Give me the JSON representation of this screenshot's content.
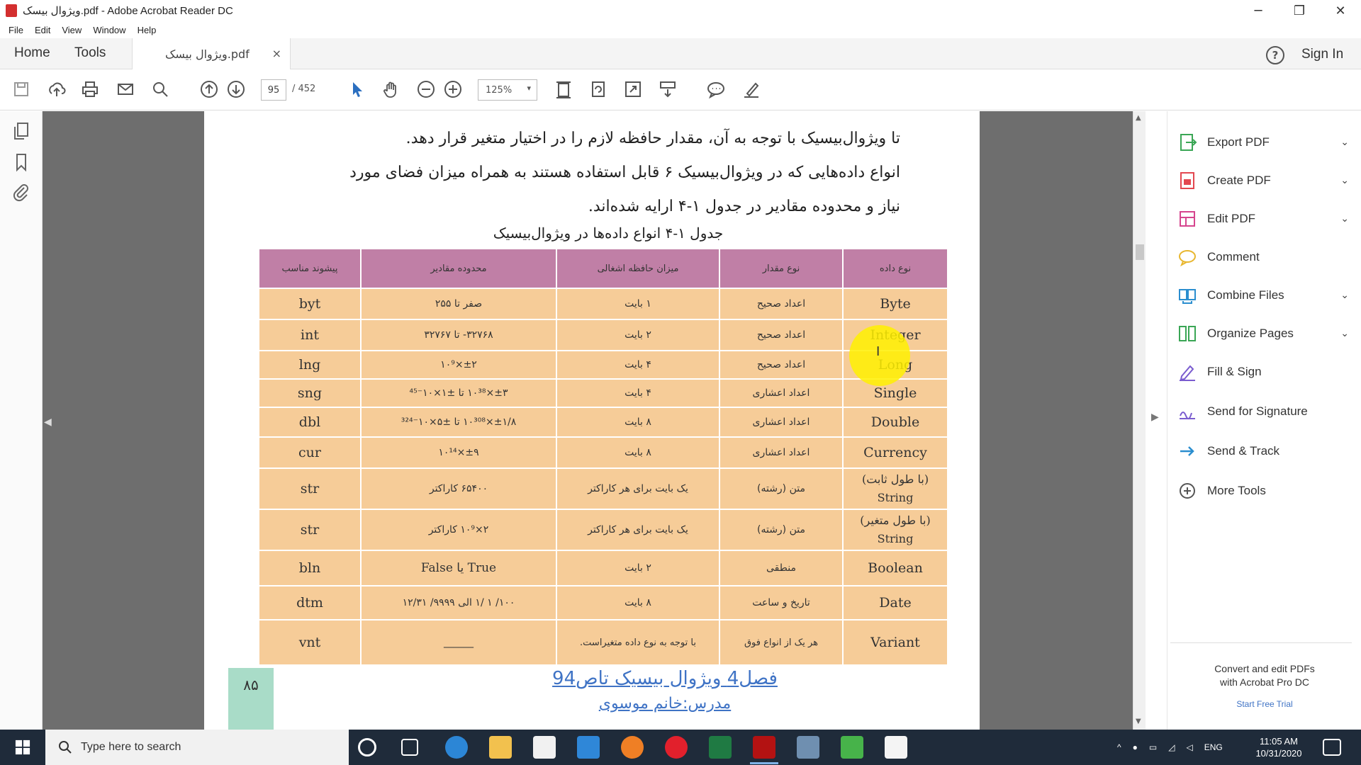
{
  "window": {
    "title": "ويژوال بيسک.pdf - Adobe Acrobat Reader DC",
    "controls": [
      "─",
      "❐",
      "✕"
    ]
  },
  "menu": [
    "File",
    "Edit",
    "View",
    "Window",
    "Help"
  ],
  "tabs": {
    "home": "Home",
    "tools": "Tools",
    "document": "ويژوال بيسک.pdf",
    "close": "×",
    "help": "?",
    "sign_in": "Sign In"
  },
  "toolbar": {
    "page_current": "95",
    "page_total": "/ 452",
    "zoom": "125%",
    "zoom_caret": "▾"
  },
  "document": {
    "paragraphs": [
      "تا ويژوال‌بيسيک با توجه به آن، مقدار حافظه لازم را در اختيار متغير قرار دهد.",
      "انواع داده‌هايی که در ويژوال‌بيسيک ۶ قابل استفاده هستند به همراه ميزان فضای مورد",
      "نياز و محدوده مقادير در جدول ۱-۴ ارايه شده‌اند."
    ],
    "caption": "جدول ۱-۴ انواع داده‌ها در ويژوال‌بيسيک",
    "table": {
      "headers": [
        "پيشوند مناسب",
        "محدوده مقادير",
        "ميزان حافظه اشغالی",
        "نوع مقدار",
        "نوع داده"
      ],
      "rows": [
        [
          "byt",
          "صفر تا ۲۵۵",
          "۱ بايت",
          "اعداد صحيح",
          "Byte"
        ],
        [
          "int",
          "۳۲۷۶۸- تا ۳۲۷۶۷",
          "۲ بايت",
          "اعداد صحيح",
          "Integer"
        ],
        [
          "lng",
          "±۲×۱۰⁹",
          "۴ بايت",
          "اعداد صحيح",
          "Long"
        ],
        [
          "sng",
          "±۳×۱۰³⁸ تا ±۱×۱۰⁻⁴⁵",
          "۴ بايت",
          "اعداد اعشاری",
          "Single"
        ],
        [
          "dbl",
          "±۱/۸×۱۰³⁰⁸ تا ±۵×۱۰⁻³²⁴",
          "۸ بايت",
          "اعداد اعشاری",
          "Double"
        ],
        [
          "cur",
          "±۹×۱۰¹⁴",
          "۸ بايت",
          "اعداد اعشاری",
          "Currency"
        ],
        [
          "str",
          "۶۵۴۰۰ کاراکتر",
          "يک بايت برای هر کاراکتر",
          "متن (رشته)",
          "(با طول ثابت) String"
        ],
        [
          "str",
          "۲×۱۰⁹ کاراکتر",
          "يک بايت برای هر کاراکتر",
          "متن (رشته)",
          "(با طول متغير) String"
        ],
        [
          "bln",
          "True يا False",
          "۲ بايت",
          "منطقی",
          "Boolean"
        ],
        [
          "dtm",
          "۱۰۰/ ۱ /۱ الی ۹۹۹۹/ ۱۲/۳۱",
          "۸ بايت",
          "تاريخ و ساعت",
          "Date"
        ],
        [
          "vnt",
          "______",
          "با توجه به نوع داده متغيراست.",
          "هر يک از انواع فوق",
          "Variant"
        ]
      ]
    },
    "page_number": "۸۵",
    "footer_title": "فصل4 ويژوال بيسيک تاص94",
    "footer_author": "مدرس:خانم موسوی",
    "cursor": "I"
  },
  "right_panel": {
    "tools": [
      {
        "label": "Export PDF",
        "icon": "export-pdf-icon",
        "color": "#3aa655",
        "chevron": "⌄"
      },
      {
        "label": "Create PDF",
        "icon": "create-pdf-icon",
        "color": "#e34850",
        "chevron": "⌄"
      },
      {
        "label": "Edit PDF",
        "icon": "edit-pdf-icon",
        "color": "#d6458e",
        "chevron": "⌄"
      },
      {
        "label": "Comment",
        "icon": "comment-icon",
        "color": "#e8b730",
        "chevron": ""
      },
      {
        "label": "Combine Files",
        "icon": "combine-files-icon",
        "color": "#2b8ecf",
        "chevron": "⌄"
      },
      {
        "label": "Organize Pages",
        "icon": "organize-pages-icon",
        "color": "#3aa655",
        "chevron": "⌄"
      },
      {
        "label": "Fill & Sign",
        "icon": "fill-sign-icon",
        "color": "#7a5ccf",
        "chevron": ""
      },
      {
        "label": "Send for Signature",
        "icon": "send-signature-icon",
        "color": "#7a5ccf",
        "chevron": ""
      },
      {
        "label": "Send & Track",
        "icon": "send-track-icon",
        "color": "#2b8ecf",
        "chevron": ""
      },
      {
        "label": "More Tools",
        "icon": "more-tools-icon",
        "color": "#555555",
        "chevron": ""
      }
    ],
    "promo_line1": "Convert and edit PDFs",
    "promo_line2": "with Acrobat Pro DC",
    "promo_link": "Start Free Trial"
  },
  "taskbar": {
    "search_placeholder": "Type here to search",
    "language": "ENG",
    "time": "11:05 AM",
    "date": "10/31/2020"
  },
  "colors": {
    "table_header": "#c07fa6",
    "table_cell": "#f6cc98",
    "page_number_box": "#a9dcc8",
    "link": "#3f73c5",
    "taskbar": "#1f2b3a"
  }
}
